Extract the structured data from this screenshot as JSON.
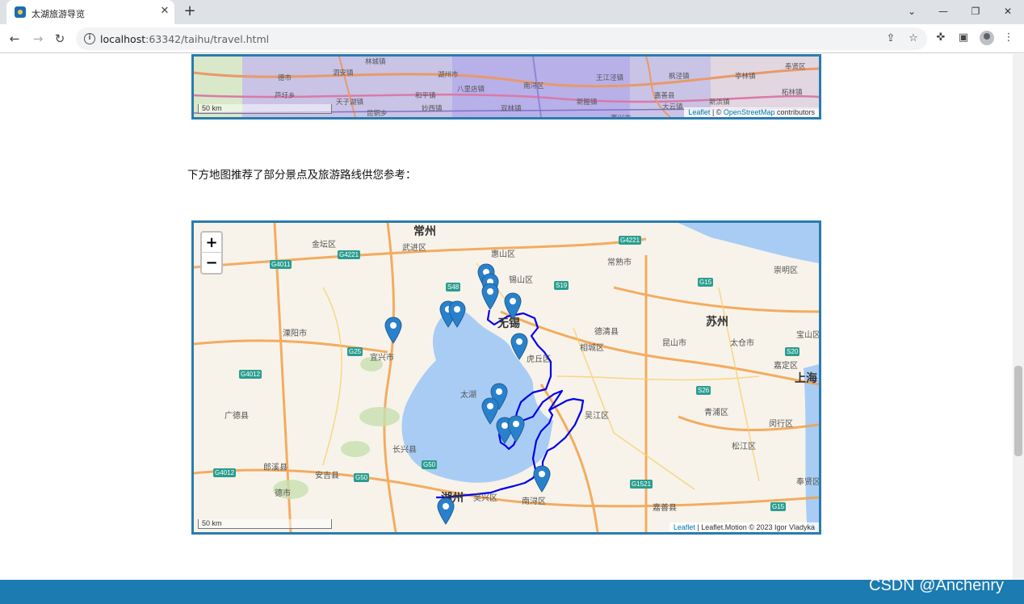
{
  "browser": {
    "tab_title": "太湖旅游导览",
    "new_tab": "+",
    "url_host": "localhost",
    "url_rest": ":63342/taihu/travel.html"
  },
  "map1": {
    "scale": "50 km",
    "attribution_leaflet": "Leaflet",
    "attribution_sep": " | © ",
    "attribution_osm": "OpenStreetMap",
    "attribution_tail": " contributors",
    "labels": [
      "德市",
      "林城镇",
      "芦圩乡",
      "泗安镇",
      "天子湖镇",
      "和平镇",
      "湖州市",
      "八里店镇",
      "南浔区",
      "王江泾镇",
      "嘉善县",
      "亭林镇",
      "新浜镇",
      "奉贤区",
      "枫泾镇",
      "柘林镇",
      "昆铜乡",
      "妙西镇",
      "双林镇",
      "新塍镇",
      "大云镇",
      "嘉兴市"
    ]
  },
  "intro_text": "下方地图推荐了部分景点及旅游路线供您参考：",
  "map2": {
    "zoom_in": "+",
    "zoom_out": "−",
    "scale": "50 km",
    "attribution_leaflet": "Leaflet",
    "attribution_tail": " | Leaflet.Motion © 2023 Igor Vladyka",
    "labels": [
      "常州",
      "金坛区",
      "武进区",
      "惠山区",
      "锡山区",
      "常熟市",
      "昆山市",
      "溧阳市",
      "宜兴市",
      "无锡",
      "虎丘区",
      "相城区",
      "苏州",
      "太仓市",
      "嘉定区",
      "上海",
      "太湖",
      "吴江区",
      "青浦区",
      "闵行区",
      "松江区",
      "长兴县",
      "湖州",
      "吴兴区",
      "南浔区",
      "嘉善县",
      "广德县",
      "郎溪县",
      "安吉县",
      "德市",
      "宝山区",
      "崇明区",
      "奉贤区",
      "德清县"
    ],
    "shields": [
      "G4011",
      "G4221",
      "S48",
      "S19",
      "G15",
      "G25",
      "G4012",
      "S20",
      "S26",
      "G50",
      "G1521",
      "G4012",
      "G50",
      "G15",
      "G4221"
    ]
  },
  "footer": {
    "watermark": "CSDN @Anchenry"
  }
}
